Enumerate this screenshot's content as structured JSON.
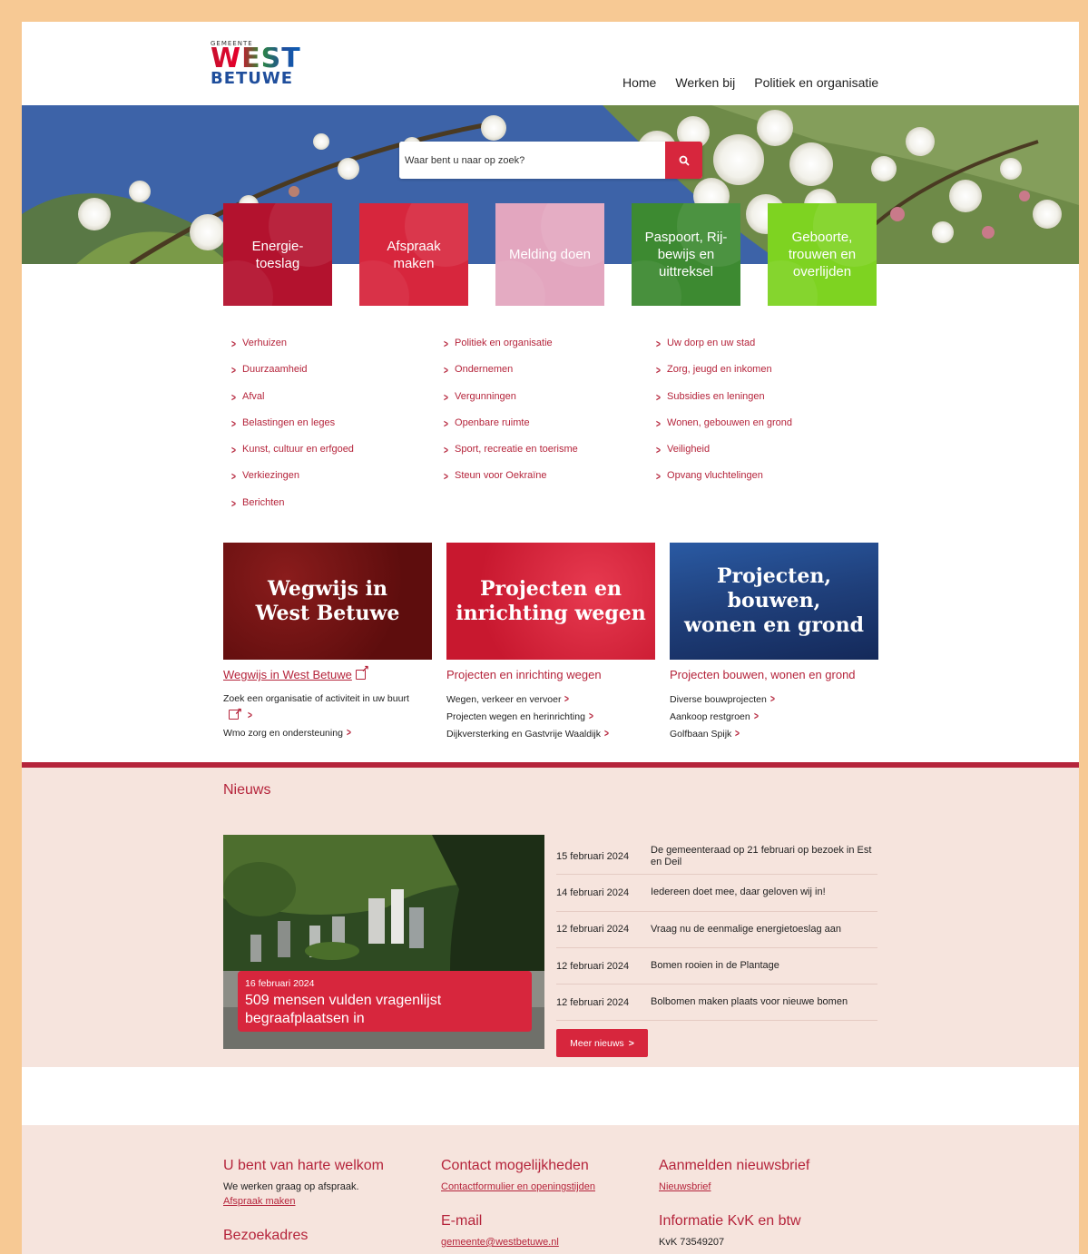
{
  "logo": {
    "small": "GEMEENTE",
    "west": "WEST",
    "betuwe": "BETUWE"
  },
  "nav": [
    "Home",
    "Werken bij",
    "Politiek en organisatie"
  ],
  "search": {
    "placeholder": "Waar bent u naar op zoek?"
  },
  "tiles": [
    {
      "label": "Energie-\ntoeslag",
      "color": "#b3122e"
    },
    {
      "label": "Afspraak\nmaken",
      "color": "#d7263d"
    },
    {
      "label": "Melding doen",
      "color": "#e3a6bf"
    },
    {
      "label": "Paspoort, Rij-\nbewijs en\nuittreksel",
      "color": "#3d8a31"
    },
    {
      "label": "Geboorte,\ntrouwen en\noverlijden",
      "color": "#7ed321"
    }
  ],
  "links": {
    "col1": [
      "Verhuizen",
      "Duurzaamheid",
      "Afval",
      "Belastingen en leges",
      "Kunst, cultuur en erfgoed",
      "Verkiezingen",
      "Berichten"
    ],
    "col2": [
      "Politiek en organisatie",
      "Ondernemen",
      "Vergunningen",
      "Openbare ruimte",
      "Sport, recreatie en toerisme",
      "Steun voor Oekraïne"
    ],
    "col3": [
      "Uw dorp en uw stad",
      "Zorg, jeugd en inkomen",
      "Subsidies en leningen",
      "Wonen, gebouwen en grond",
      "Veiligheid",
      "Opvang vluchtelingen"
    ]
  },
  "cards": [
    {
      "image_text": "Wegwijs in\nWest Betuwe",
      "title": "Wegwijs in West Betuwe",
      "sub1": "Zoek een organisatie of activiteit in uw buurt",
      "sub2": "Wmo zorg en ondersteuning",
      "color": "#7a1414"
    },
    {
      "image_text": "Projecten en\ninrichting wegen",
      "title": "Projecten en inrichting wegen",
      "sub1": "Wegen, verkeer en vervoer",
      "sub2": "Projecten wegen en herinrichting",
      "sub3": "Dijkversterking en Gastvrije Waaldijk",
      "color": "#d7263d"
    },
    {
      "image_text": "Projecten, bouwen,\nwonen en grond",
      "title": "Projecten bouwen, wonen en grond",
      "sub1": "Diverse bouwprojecten",
      "sub2": "Aankoop restgroen",
      "sub3": "Golfbaan Spijk",
      "color": "#1f3f7a"
    }
  ],
  "news": {
    "title": "Nieuws",
    "featured": {
      "date": "16 februari 2024",
      "title": "509 mensen vulden vragenlijst begraafplaatsen in"
    },
    "items": [
      {
        "date": "15 februari 2024",
        "title": "De gemeenteraad op 21 februari op bezoek in Est en Deil"
      },
      {
        "date": "14 februari 2024",
        "title": "Iedereen doet mee, daar geloven wij in!"
      },
      {
        "date": "12 februari 2024",
        "title": "Vraag nu de eenmalige energietoeslag aan"
      },
      {
        "date": "12 februari 2024",
        "title": "Bomen rooien in de Plantage"
      },
      {
        "date": "12 februari 2024",
        "title": "Bolbomen maken plaats voor nieuwe bomen"
      }
    ],
    "more_label": "Meer nieuws"
  },
  "footer": {
    "welcome": {
      "heading": "U bent van harte welkom",
      "text": "We werken graag op afspraak.",
      "link": "Afspraak maken"
    },
    "visit": {
      "heading": "Bezoekadres"
    },
    "contact": {
      "heading": "Contact mogelijkheden",
      "link": "Contactformulier en openingstijden"
    },
    "email": {
      "heading": "E-mail",
      "link": "gemeente@westbetuwe.nl"
    },
    "newsletter": {
      "heading": "Aanmelden nieuwsbrief",
      "link": "Nieuwsbrief"
    },
    "kvk": {
      "heading": "Informatie KvK en btw",
      "text": "KvK 73549207"
    }
  }
}
